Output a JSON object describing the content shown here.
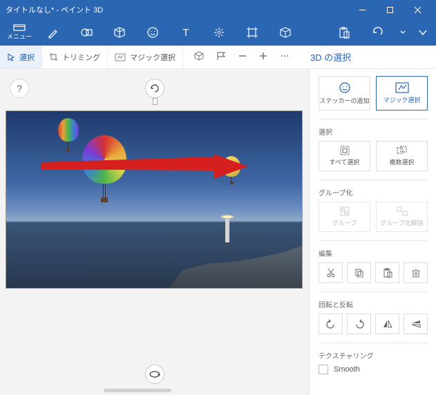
{
  "titlebar": {
    "title": "タイトルなし* - ペイント 3D"
  },
  "ribbon": {
    "menu_label": "メニュー"
  },
  "toolbar": {
    "select_label": "選択",
    "trimming_label": "トリミング",
    "magic_label": "マジック選択"
  },
  "panel": {
    "title": "3D の選択",
    "sticker_btn": "ステッカーの追加",
    "magic_btn": "マジック選択",
    "section_select": "選択",
    "select_all": "すべて選択",
    "multi_select": "複数選択",
    "section_group": "グループ化",
    "group_btn": "グループ",
    "ungroup_btn": "グループ化解除",
    "section_edit": "編集",
    "section_rotate": "回転と反転",
    "section_texture": "テクスチャリング",
    "smooth_label": "Smooth"
  },
  "help": {
    "badge": "?"
  }
}
